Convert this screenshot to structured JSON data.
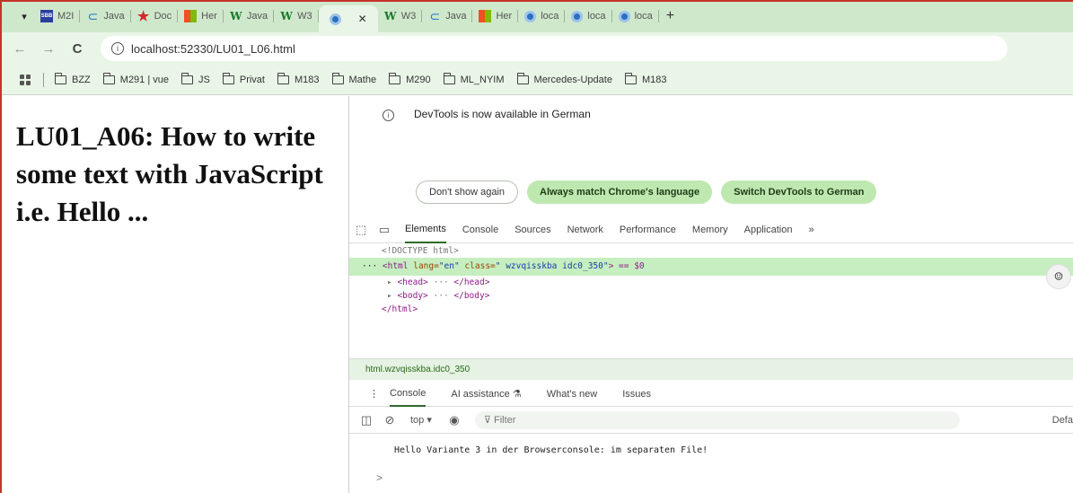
{
  "tabs": [
    {
      "label": "M2I",
      "icon": "sbb-icon"
    },
    {
      "label": "Java",
      "icon": "doc-icon"
    },
    {
      "label": "Doc",
      "icon": "star-icon"
    },
    {
      "label": "Her",
      "icon": "microsoft-icon"
    },
    {
      "label": "Java",
      "icon": "w3-icon"
    },
    {
      "label": "W3",
      "icon": "w3-icon"
    },
    {
      "label": "W3",
      "icon": "w3-icon"
    },
    {
      "label": "Java",
      "icon": "doc-icon"
    },
    {
      "label": "Her",
      "icon": "microsoft-icon"
    },
    {
      "label": "loca",
      "icon": "chrome-icon"
    },
    {
      "label": "loca",
      "icon": "chrome-icon"
    },
    {
      "label": "loca",
      "icon": "chrome-icon"
    }
  ],
  "address": {
    "url": "localhost:52330/LU01_L06.html"
  },
  "bookmarks": [
    "BZZ",
    "M291 | vue",
    "JS",
    "Privat",
    "M183",
    "Mathe",
    "M290",
    "ML_NYIM",
    "Mercedes-Update",
    "M183"
  ],
  "page": {
    "heading": "LU01_A06: How to write some text with JavaScript i.e. Hello ..."
  },
  "devtools": {
    "banner_text": "DevTools is now available in German",
    "btn_dont_show": "Don't show again",
    "btn_match": "Always match Chrome's language",
    "btn_switch": "Switch DevTools to German",
    "tabs": [
      "Elements",
      "Console",
      "Sources",
      "Network",
      "Performance",
      "Memory",
      "Application"
    ],
    "elements": {
      "doctype": "<!DOCTYPE html>",
      "html_tag": "<html",
      "lang_attr": " lang=",
      "lang_val": "\"en\"",
      "class_attr": " class=",
      "class_val": "\" wzvqisskba idc0_350\"",
      "sel_suffix": "> == $0",
      "head": "<head>",
      "head_close": "</head>",
      "body": "<body>",
      "body_close": "</body>",
      "html_close": "</html>"
    },
    "breadcrumb": "html.wzvqisskba.idc0_350",
    "drawer_tabs": [
      "Console",
      "AI assistance",
      "What's new",
      "Issues"
    ],
    "context": "top",
    "filter_placeholder": "Filter",
    "levels": "Defa",
    "console_message": "Hello Variante 3 in der Browserconsole: im separaten File!",
    "prompt": ">"
  }
}
